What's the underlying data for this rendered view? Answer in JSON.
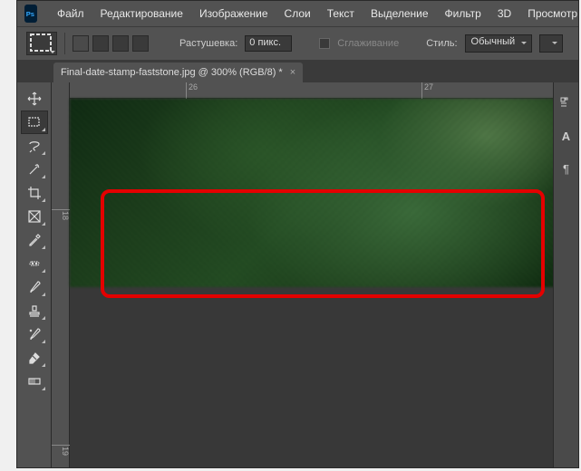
{
  "menu": {
    "items": [
      "Файл",
      "Редактирование",
      "Изображение",
      "Слои",
      "Текст",
      "Выделение",
      "Фильтр",
      "3D",
      "Просмотр"
    ]
  },
  "options": {
    "feather_label": "Растушевка:",
    "feather_value": "0 пикс.",
    "antialias_label": "Сглаживание",
    "style_label": "Стиль:",
    "style_value": "Обычный"
  },
  "tab": {
    "title": "Final-date-stamp-faststone.jpg @ 300% (RGB/8) *",
    "close": "×"
  },
  "rulers": {
    "h": [
      {
        "label": "26",
        "pos": 128
      },
      {
        "label": "27",
        "pos": 388
      }
    ],
    "v": [
      {
        "label": "18",
        "pos": 140
      },
      {
        "label": "19",
        "pos": 400
      }
    ]
  },
  "right_panel": {
    "icons": [
      "dots",
      "A",
      "paragraph"
    ]
  }
}
